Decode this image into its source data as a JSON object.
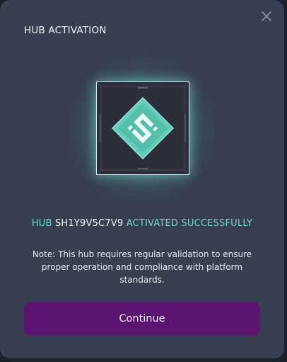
{
  "modal": {
    "title": "HUB ACTIVATION",
    "close_icon": "close-icon"
  },
  "hero": {
    "icon": "hub-diamond-logo-icon",
    "colors": {
      "glow": "#6fe8d8",
      "diamond": "#5fc7b6",
      "frame": "#2c2f3b"
    }
  },
  "status": {
    "prefix": "HUB",
    "hub_id": "SH1Y9V5C7V9",
    "suffix": "ACTIVATED SUCCESSFULLY"
  },
  "note": {
    "text": "Note: This hub requires regular validation to ensure proper operation and compliance with platform standards."
  },
  "actions": {
    "continue_label": "Continue"
  },
  "colors": {
    "accent": "#6fd5c4",
    "button": "#5b1470",
    "modal_bg": "#373f51"
  }
}
